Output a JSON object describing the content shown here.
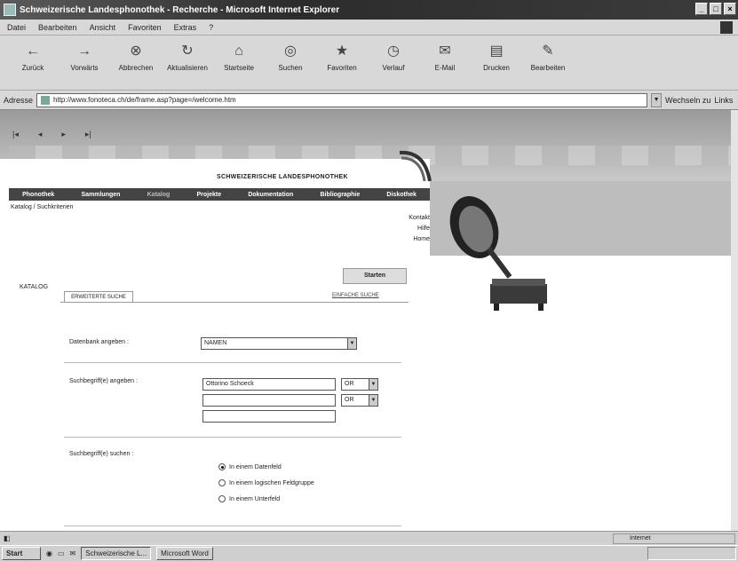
{
  "window": {
    "title": "Schweizerische Landesphonothek - Recherche - Microsoft Internet Explorer"
  },
  "menubar": [
    "Datei",
    "Bearbeiten",
    "Ansicht",
    "Favoriten",
    "Extras",
    "?"
  ],
  "toolbar": [
    {
      "label": "Zurück",
      "icon": "back-arrow-icon"
    },
    {
      "label": "Vorwärts",
      "icon": "forward-arrow-icon"
    },
    {
      "label": "Abbrechen",
      "icon": "stop-icon"
    },
    {
      "label": "Aktualisieren",
      "icon": "refresh-icon"
    },
    {
      "label": "Startseite",
      "icon": "home-icon"
    },
    {
      "label": "Suchen",
      "icon": "search-icon"
    },
    {
      "label": "Favoriten",
      "icon": "favorites-icon"
    },
    {
      "label": "Verlauf",
      "icon": "history-icon"
    },
    {
      "label": "E-Mail",
      "icon": "mail-icon"
    },
    {
      "label": "Drucken",
      "icon": "print-icon"
    },
    {
      "label": "Bearbeiten",
      "icon": "edit-icon"
    }
  ],
  "address": {
    "label": "Adresse",
    "url": "http://www.fonoteca.ch/de/frame.asp?page=/welcome.htm",
    "go_label": "Wechseln zu",
    "links_label": "Links"
  },
  "site": {
    "logo_text": "SCHWEIZERISCHE LANDESPHONOTHEK",
    "nav": [
      "Phonothek",
      "Sammlungen",
      "Katalog",
      "Projekte",
      "Dokumentation",
      "Bibliographie",
      "Diskothek"
    ],
    "breadcrumb": "Katalog / Suchkriterien",
    "side_links": [
      "Kontakt",
      "Hilfe",
      "Home"
    ]
  },
  "search": {
    "katalog_label": "KATALOG",
    "tab_erweitert": "ERWEITERTE SUCHE",
    "einfache_link": "EINFACHE SUCHE",
    "start_button": "Starten",
    "datenbank_label": "Datenbank angeben :",
    "datenbank_value": "NAMEN",
    "suchbegriff_label": "Suchbegriff(e) angeben :",
    "suchbegriff_1": "Ottorino Schoeck",
    "suchbegriff_2": "",
    "suchbegriff_3": "",
    "operator_1": "OR",
    "operator_2": "OR",
    "suchen_label": "Suchbegriff(e) suchen :",
    "radio_options": [
      {
        "label": "In einem Datenfeld",
        "checked": true
      },
      {
        "label": "In einem logischen Feldgruppe",
        "checked": false
      },
      {
        "label": "In einem Unterfeld",
        "checked": false
      }
    ]
  },
  "statusbar": {
    "zone": "Internet"
  },
  "taskbar": {
    "start": "Start",
    "tasks": [
      "Schweizerische L...",
      "Microsoft Word"
    ]
  }
}
